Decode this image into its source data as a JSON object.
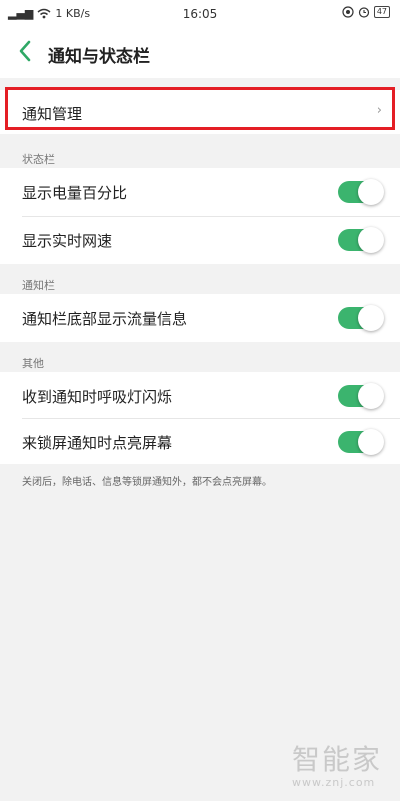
{
  "status_bar": {
    "signal": "▂▄▆",
    "speed": "1 KB/s",
    "time": "16:05",
    "battery": "47"
  },
  "header": {
    "back_icon": "‹",
    "title": "通知与状态栏"
  },
  "notification_manage": {
    "label": "通知管理",
    "chevron": "›"
  },
  "sections": {
    "status_bar": {
      "title": "状态栏",
      "items": [
        {
          "label": "显示电量百分比",
          "on": true
        },
        {
          "label": "显示实时网速",
          "on": true
        }
      ]
    },
    "notification_bar": {
      "title": "通知栏",
      "items": [
        {
          "label": "通知栏底部显示流量信息",
          "on": true
        }
      ]
    },
    "other": {
      "title": "其他",
      "items": [
        {
          "label": "收到通知时呼吸灯闪烁",
          "on": true
        },
        {
          "label": "来锁屏通知时点亮屏幕",
          "on": true
        }
      ]
    }
  },
  "footnote": "关闭后，除电话、信息等锁屏通知外，都不会点亮屏幕。",
  "watermark": {
    "cn": "智能家",
    "url": "www.znj.com"
  },
  "colors": {
    "toggle_on": "#3bb46e",
    "highlight": "#e41e25",
    "accent_back": "#2fa866"
  }
}
